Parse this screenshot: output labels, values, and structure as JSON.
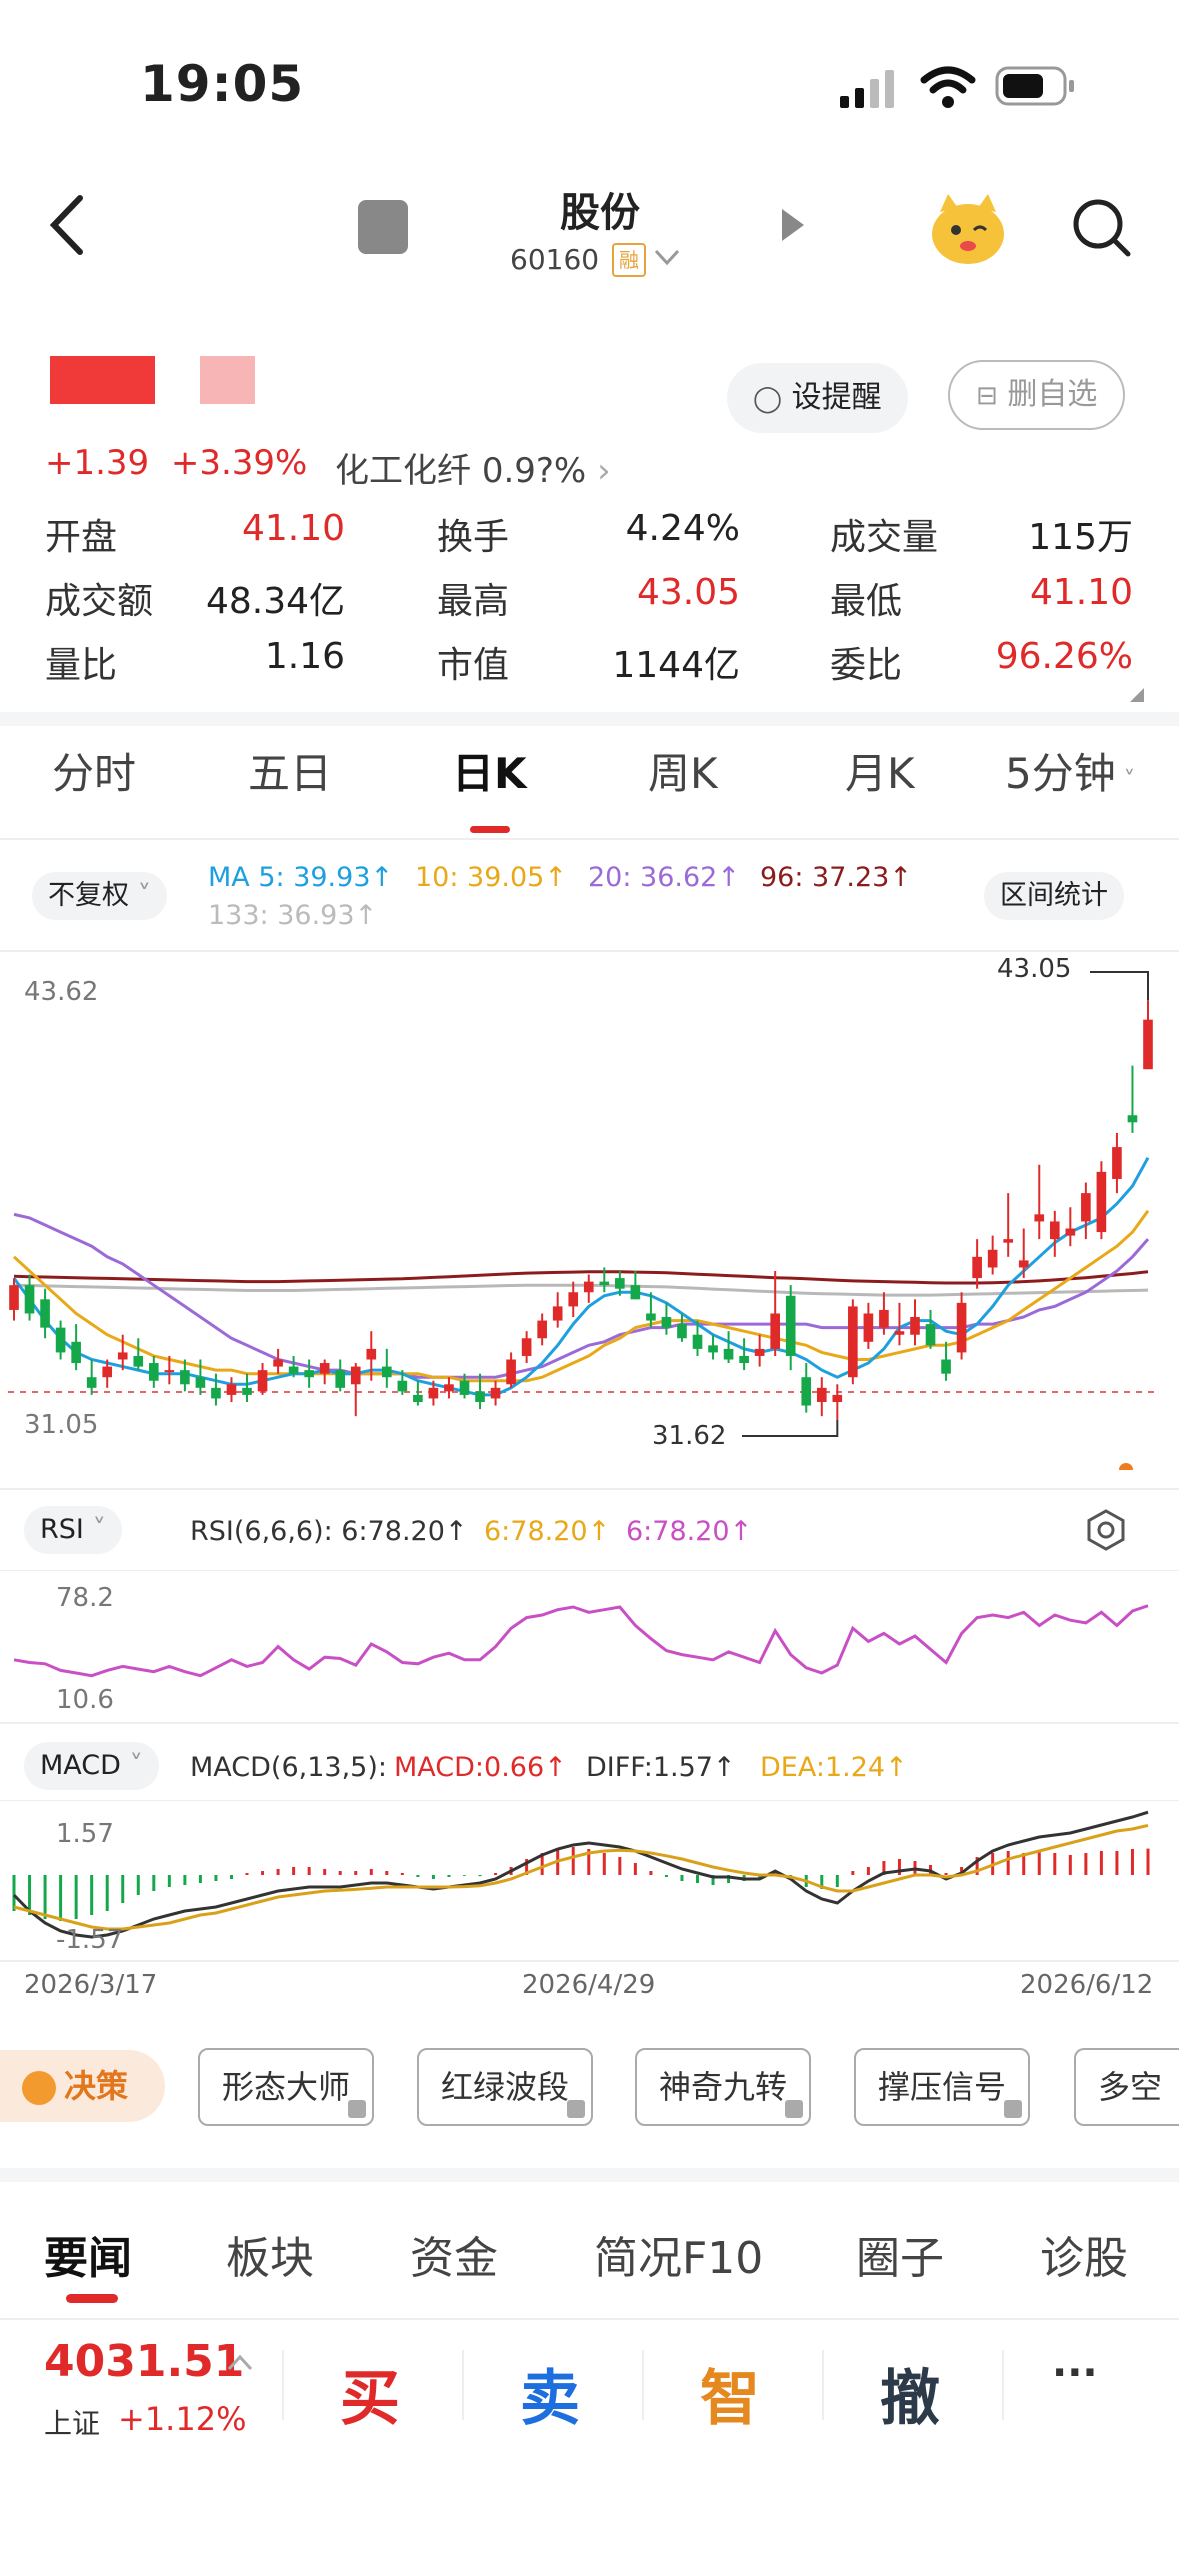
{
  "status": {
    "time": "19:05"
  },
  "header": {
    "name_fragment": "股份",
    "code_fragment": "60160",
    "rong_badge": "融"
  },
  "actions": {
    "remind": "设提醒",
    "remove_fav": "删自选"
  },
  "quote": {
    "change": "+1.39",
    "change_pct": "+3.39%",
    "sector": "化工化纤",
    "sector_pct": "0.9?%"
  },
  "stats": [
    {
      "label": "开盘",
      "value": "41.10",
      "color": "#e02a2a"
    },
    {
      "label": "换手",
      "value": "4.24%",
      "color": "#222222"
    },
    {
      "label": "成交量",
      "value": "115万",
      "color": "#222222"
    },
    {
      "label": "成交额",
      "value": "48.34亿",
      "color": "#222222"
    },
    {
      "label": "最高",
      "value": "43.05",
      "color": "#e02a2a"
    },
    {
      "label": "最低",
      "value": "41.10",
      "color": "#e02a2a"
    },
    {
      "label": "量比",
      "value": "1.16",
      "color": "#222222"
    },
    {
      "label": "市值",
      "value": "1144亿",
      "color": "#222222"
    },
    {
      "label": "委比",
      "value": "96.26%",
      "color": "#e02a2a"
    }
  ],
  "period_tabs": [
    "分时",
    "五日",
    "日K",
    "周K",
    "月K",
    "5分钟"
  ],
  "active_tab": "日K",
  "chart_controls": {
    "adjust": "不复权",
    "range_stats": "区间统计"
  },
  "ma_legend": {
    "ma5": "MA 5: 39.93↑",
    "ma10": "10: 39.05↑",
    "ma20": "20: 36.62↑",
    "ma96": "96: 37.23↑",
    "ma133": "133: 36.93↑"
  },
  "rsi_legend": {
    "chip": "RSI",
    "r1": "RSI(6,6,6): 6:78.20↑",
    "r2": "6:78.20↑",
    "r3": "6:78.20↑"
  },
  "macd_legend": {
    "chip": "MACD",
    "params": "MACD(6,13,5):",
    "macd": "MACD:0.66↑",
    "diff": "DIFF:1.57↑",
    "dea": "DEA:1.24↑"
  },
  "labels": {
    "ymax": "43.62",
    "ymin": "31.05",
    "high": "43.05",
    "low": "31.62",
    "rsi_hi": "78.2",
    "rsi_lo": "10.6",
    "macd_hi": "1.57",
    "macd_lo": "-1.57"
  },
  "dates": [
    "2026/3/17",
    "2026/4/29",
    "2026/6/12"
  ],
  "decision": "决策",
  "signals": [
    "形态大师",
    "红绿波段",
    "神奇九转",
    "撑压信号",
    "多空"
  ],
  "bottom_tabs": [
    "要闻",
    "板块",
    "资金",
    "简况F10",
    "圈子",
    "诊股"
  ],
  "index": {
    "value": "4031.51",
    "name": "上证",
    "pct": "+1.12%"
  },
  "trade": {
    "buy": "买",
    "sell": "卖",
    "smart": "智",
    "cancel": "撤",
    "more": "···"
  },
  "colors": {
    "up": "#e02a2a",
    "down": "#14a84a",
    "ma5": "#1ea0e0",
    "ma10": "#e8a817",
    "ma20": "#9b6ad8",
    "ma96": "#8c1c1c",
    "ma133": "#b8b8b8",
    "rsi": "#c94fc4",
    "dea": "#d9a11a"
  },
  "chart_data": {
    "type": "candlestick",
    "ylim": [
      31.05,
      43.62
    ],
    "candles": [
      [
        34.3,
        35.2,
        34.0,
        35.0
      ],
      [
        35.0,
        35.3,
        34.0,
        34.2
      ],
      [
        34.6,
        34.9,
        33.5,
        33.8
      ],
      [
        33.8,
        34.0,
        32.9,
        33.1
      ],
      [
        33.4,
        33.9,
        32.6,
        32.8
      ],
      [
        32.4,
        32.9,
        31.9,
        32.1
      ],
      [
        32.4,
        32.9,
        32.1,
        32.7
      ],
      [
        32.9,
        33.6,
        32.6,
        33.1
      ],
      [
        33.0,
        33.5,
        32.6,
        32.7
      ],
      [
        32.8,
        33.0,
        32.1,
        32.3
      ],
      [
        32.6,
        33.0,
        32.2,
        32.6
      ],
      [
        32.6,
        32.9,
        32.0,
        32.2
      ],
      [
        32.4,
        32.9,
        31.9,
        32.1
      ],
      [
        32.1,
        32.5,
        31.6,
        31.8
      ],
      [
        31.9,
        32.4,
        31.7,
        32.2
      ],
      [
        32.1,
        32.5,
        31.7,
        31.9
      ],
      [
        32.0,
        32.8,
        31.9,
        32.6
      ],
      [
        32.7,
        33.2,
        32.5,
        32.9
      ],
      [
        32.7,
        33.0,
        32.4,
        32.5
      ],
      [
        32.6,
        32.9,
        32.1,
        32.4
      ],
      [
        32.5,
        32.9,
        32.2,
        32.8
      ],
      [
        32.6,
        32.9,
        32.0,
        32.1
      ],
      [
        32.2,
        32.8,
        31.3,
        32.7
      ],
      [
        32.9,
        33.7,
        32.3,
        33.2
      ],
      [
        32.7,
        33.2,
        32.1,
        32.4
      ],
      [
        32.3,
        32.6,
        31.9,
        32.0
      ],
      [
        31.9,
        32.3,
        31.6,
        31.7
      ],
      [
        31.8,
        32.3,
        31.6,
        32.1
      ],
      [
        32.0,
        32.4,
        31.8,
        32.2
      ],
      [
        32.3,
        32.5,
        31.8,
        31.9
      ],
      [
        32.0,
        32.5,
        31.5,
        31.7
      ],
      [
        31.8,
        32.3,
        31.6,
        32.1
      ],
      [
        32.2,
        33.1,
        32.1,
        32.9
      ],
      [
        33.0,
        33.7,
        32.8,
        33.5
      ],
      [
        33.5,
        34.2,
        33.3,
        34.0
      ],
      [
        34.0,
        34.8,
        33.8,
        34.4
      ],
      [
        34.4,
        35.1,
        34.1,
        34.8
      ],
      [
        34.8,
        35.3,
        34.5,
        35.1
      ],
      [
        35.1,
        35.5,
        34.8,
        35.0
      ],
      [
        35.2,
        35.4,
        34.7,
        34.9
      ],
      [
        35.0,
        35.4,
        34.6,
        34.6
      ],
      [
        34.2,
        34.8,
        33.8,
        34.0
      ],
      [
        34.1,
        34.5,
        33.6,
        33.8
      ],
      [
        33.9,
        34.2,
        33.4,
        33.5
      ],
      [
        33.6,
        34.0,
        33.0,
        33.2
      ],
      [
        33.3,
        33.6,
        32.9,
        33.1
      ],
      [
        33.2,
        33.7,
        32.8,
        32.9
      ],
      [
        33.0,
        33.5,
        32.6,
        32.8
      ],
      [
        33.0,
        33.6,
        32.7,
        33.2
      ],
      [
        33.2,
        35.4,
        33.0,
        34.2
      ],
      [
        34.7,
        35.0,
        32.6,
        33.0
      ],
      [
        32.4,
        32.8,
        31.4,
        31.6
      ],
      [
        31.7,
        32.4,
        31.3,
        32.1
      ],
      [
        31.7,
        32.2,
        31.2,
        31.9
      ],
      [
        32.4,
        34.6,
        32.2,
        34.4
      ],
      [
        33.4,
        34.5,
        33.2,
        34.2
      ],
      [
        33.8,
        34.8,
        33.6,
        34.3
      ],
      [
        33.6,
        34.5,
        33.3,
        33.7
      ],
      [
        33.6,
        34.6,
        33.3,
        34.1
      ],
      [
        33.9,
        34.3,
        33.2,
        33.3
      ],
      [
        32.9,
        33.4,
        32.3,
        32.5
      ],
      [
        33.1,
        34.8,
        32.9,
        34.5
      ],
      [
        35.2,
        36.3,
        34.9,
        35.8
      ],
      [
        35.5,
        36.4,
        35.3,
        36.0
      ],
      [
        36.2,
        37.6,
        35.8,
        36.3
      ],
      [
        35.5,
        36.6,
        35.2,
        35.7
      ],
      [
        36.8,
        38.4,
        36.3,
        37.0
      ],
      [
        36.3,
        37.1,
        35.8,
        36.8
      ],
      [
        36.4,
        37.2,
        36.1,
        36.6
      ],
      [
        36.8,
        37.9,
        36.3,
        37.6
      ],
      [
        36.5,
        38.5,
        36.3,
        38.2
      ],
      [
        38.0,
        39.3,
        37.6,
        38.9
      ],
      [
        39.8,
        41.2,
        39.3,
        39.6
      ],
      [
        41.1,
        43.05,
        41.1,
        42.5
      ]
    ],
    "ma5": [
      35.2,
      34.6,
      34.0,
      33.5,
      33.1,
      32.9,
      32.8,
      32.7,
      32.6,
      32.5,
      32.5,
      32.5,
      32.4,
      32.3,
      32.2,
      32.2,
      32.3,
      32.4,
      32.5,
      32.5,
      32.6,
      32.5,
      32.5,
      32.6,
      32.6,
      32.5,
      32.3,
      32.2,
      32.1,
      32.0,
      31.9,
      31.9,
      32.1,
      32.4,
      32.8,
      33.3,
      33.9,
      34.4,
      34.7,
      34.8,
      34.8,
      34.7,
      34.5,
      34.2,
      33.9,
      33.6,
      33.4,
      33.2,
      33.1,
      33.2,
      33.1,
      32.9,
      32.6,
      32.4,
      32.6,
      32.8,
      33.2,
      33.8,
      34.0,
      34.0,
      33.7,
      33.6,
      33.9,
      34.4,
      35.0,
      35.4,
      35.8,
      36.2,
      36.5,
      36.7,
      36.9,
      37.3,
      37.8,
      38.6
    ],
    "ma10": [
      35.8,
      35.4,
      35.0,
      34.6,
      34.2,
      33.9,
      33.6,
      33.4,
      33.2,
      33.0,
      32.9,
      32.8,
      32.7,
      32.6,
      32.6,
      32.5,
      32.5,
      32.5,
      32.5,
      32.5,
      32.5,
      32.5,
      32.5,
      32.5,
      32.5,
      32.5,
      32.5,
      32.4,
      32.4,
      32.3,
      32.3,
      32.3,
      32.3,
      32.3,
      32.4,
      32.6,
      32.8,
      33.0,
      33.3,
      33.5,
      33.8,
      33.9,
      34.0,
      34.0,
      34.0,
      33.9,
      33.8,
      33.7,
      33.6,
      33.5,
      33.4,
      33.3,
      33.1,
      33.0,
      32.9,
      32.9,
      33.0,
      33.1,
      33.2,
      33.3,
      33.3,
      33.4,
      33.6,
      33.8,
      34.0,
      34.3,
      34.6,
      34.9,
      35.2,
      35.5,
      35.8,
      36.1,
      36.5,
      37.1
    ],
    "ma20": [
      37.0,
      36.9,
      36.7,
      36.5,
      36.3,
      36.1,
      35.8,
      35.6,
      35.3,
      35.0,
      34.7,
      34.4,
      34.1,
      33.8,
      33.5,
      33.3,
      33.1,
      32.9,
      32.8,
      32.7,
      32.6,
      32.6,
      32.5,
      32.5,
      32.5,
      32.5,
      32.4,
      32.4,
      32.4,
      32.4,
      32.4,
      32.4,
      32.5,
      32.6,
      32.7,
      32.9,
      33.1,
      33.3,
      33.4,
      33.6,
      33.7,
      33.8,
      33.8,
      33.9,
      33.9,
      33.9,
      33.9,
      33.9,
      33.9,
      33.9,
      33.9,
      33.9,
      33.8,
      33.8,
      33.8,
      33.8,
      33.8,
      33.8,
      33.8,
      33.8,
      33.8,
      33.8,
      33.9,
      33.9,
      34.0,
      34.1,
      34.3,
      34.4,
      34.6,
      34.8,
      35.1,
      35.4,
      35.8,
      36.3
    ],
    "ma96": [
      35.25,
      35.24,
      35.23,
      35.22,
      35.21,
      35.2,
      35.19,
      35.18,
      35.17,
      35.16,
      35.15,
      35.14,
      35.13,
      35.12,
      35.11,
      35.1,
      35.1,
      35.1,
      35.11,
      35.12,
      35.13,
      35.14,
      35.15,
      35.16,
      35.17,
      35.18,
      35.2,
      35.22,
      35.24,
      35.26,
      35.28,
      35.3,
      35.32,
      35.34,
      35.35,
      35.36,
      35.37,
      35.38,
      35.38,
      35.38,
      35.37,
      35.36,
      35.35,
      35.33,
      35.31,
      35.29,
      35.27,
      35.25,
      35.23,
      35.21,
      35.2,
      35.18,
      35.16,
      35.14,
      35.12,
      35.11,
      35.1,
      35.09,
      35.08,
      35.07,
      35.06,
      35.06,
      35.06,
      35.07,
      35.08,
      35.1,
      35.12,
      35.15,
      35.18,
      35.21,
      35.25,
      35.29,
      35.33,
      35.38
    ],
    "ma133": [
      35.0,
      34.99,
      34.98,
      34.97,
      34.96,
      34.95,
      34.94,
      34.93,
      34.92,
      34.91,
      34.9,
      34.89,
      34.88,
      34.87,
      34.86,
      34.85,
      34.85,
      34.85,
      34.85,
      34.86,
      34.87,
      34.88,
      34.89,
      34.9,
      34.91,
      34.92,
      34.93,
      34.94,
      34.95,
      34.96,
      34.97,
      34.98,
      34.99,
      35.0,
      35.0,
      35.0,
      35.0,
      35.0,
      34.99,
      34.98,
      34.97,
      34.96,
      34.95,
      34.93,
      34.91,
      34.89,
      34.87,
      34.85,
      34.83,
      34.81,
      34.79,
      34.77,
      34.76,
      34.75,
      34.74,
      34.73,
      34.72,
      34.72,
      34.72,
      34.72,
      34.73,
      34.74,
      34.75,
      34.76,
      34.77,
      34.78,
      34.79,
      34.8,
      34.81,
      34.82,
      34.83,
      34.84,
      34.85,
      34.86
    ],
    "rsi": [
      38,
      36,
      35,
      30,
      28,
      26,
      30,
      33,
      31,
      29,
      33,
      29,
      26,
      32,
      38,
      33,
      36,
      48,
      38,
      31,
      40,
      39,
      34,
      50,
      44,
      36,
      35,
      40,
      43,
      38,
      38,
      48,
      62,
      70,
      72,
      76,
      78,
      74,
      76,
      78,
      64,
      54,
      45,
      42,
      40,
      38,
      44,
      40,
      36,
      60,
      42,
      32,
      28,
      34,
      62,
      52,
      58,
      50,
      56,
      46,
      36,
      58,
      70,
      72,
      70,
      74,
      64,
      72,
      68,
      66,
      74,
      64,
      75,
      79
    ],
    "macd_hist": [
      -0.9,
      -1.0,
      -1.1,
      -1.15,
      -1.1,
      -1.0,
      -0.9,
      -0.7,
      -0.5,
      -0.4,
      -0.3,
      -0.25,
      -0.2,
      -0.15,
      -0.1,
      0.05,
      0.1,
      0.15,
      0.2,
      0.2,
      0.15,
      0.1,
      0.1,
      0.15,
      0.1,
      0.05,
      -0.05,
      -0.1,
      -0.05,
      -0.02,
      -0.03,
      0.05,
      0.2,
      0.4,
      0.55,
      0.65,
      0.7,
      0.65,
      0.55,
      0.45,
      0.3,
      0.1,
      -0.05,
      -0.15,
      -0.2,
      -0.25,
      -0.2,
      -0.15,
      -0.1,
      0.1,
      -0.1,
      -0.3,
      -0.35,
      -0.3,
      0.1,
      0.2,
      0.35,
      0.4,
      0.35,
      0.25,
      0.05,
      0.2,
      0.45,
      0.55,
      0.6,
      0.55,
      0.6,
      0.55,
      0.5,
      0.55,
      0.6,
      0.6,
      0.65,
      0.66
    ],
    "macd_diff": [
      -0.5,
      -0.9,
      -1.2,
      -1.4,
      -1.5,
      -1.55,
      -1.5,
      -1.4,
      -1.25,
      -1.1,
      -1.0,
      -0.9,
      -0.85,
      -0.8,
      -0.7,
      -0.6,
      -0.5,
      -0.4,
      -0.35,
      -0.3,
      -0.3,
      -0.3,
      -0.25,
      -0.2,
      -0.2,
      -0.25,
      -0.3,
      -0.35,
      -0.3,
      -0.25,
      -0.2,
      -0.1,
      0.1,
      0.3,
      0.5,
      0.65,
      0.75,
      0.8,
      0.75,
      0.7,
      0.6,
      0.45,
      0.3,
      0.15,
      0.05,
      -0.05,
      -0.05,
      -0.1,
      -0.1,
      0.1,
      -0.1,
      -0.4,
      -0.6,
      -0.7,
      -0.4,
      -0.15,
      0.05,
      0.1,
      0.15,
      0.1,
      -0.1,
      0.05,
      0.35,
      0.6,
      0.75,
      0.85,
      0.95,
      1.0,
      1.05,
      1.15,
      1.25,
      1.35,
      1.45,
      1.57
    ],
    "macd_dea": [
      -0.8,
      -0.9,
      -1.0,
      -1.1,
      -1.2,
      -1.3,
      -1.35,
      -1.35,
      -1.3,
      -1.25,
      -1.2,
      -1.1,
      -1.0,
      -0.95,
      -0.85,
      -0.75,
      -0.65,
      -0.55,
      -0.5,
      -0.45,
      -0.4,
      -0.38,
      -0.36,
      -0.33,
      -0.3,
      -0.3,
      -0.3,
      -0.3,
      -0.3,
      -0.29,
      -0.27,
      -0.2,
      -0.1,
      0.05,
      0.2,
      0.35,
      0.45,
      0.55,
      0.6,
      0.62,
      0.6,
      0.55,
      0.48,
      0.4,
      0.3,
      0.2,
      0.12,
      0.05,
      0.0,
      0.0,
      -0.05,
      -0.15,
      -0.3,
      -0.4,
      -0.4,
      -0.3,
      -0.2,
      -0.1,
      0.0,
      0.0,
      -0.05,
      0.0,
      0.1,
      0.25,
      0.4,
      0.5,
      0.6,
      0.7,
      0.8,
      0.9,
      1.0,
      1.1,
      1.15,
      1.24
    ]
  }
}
